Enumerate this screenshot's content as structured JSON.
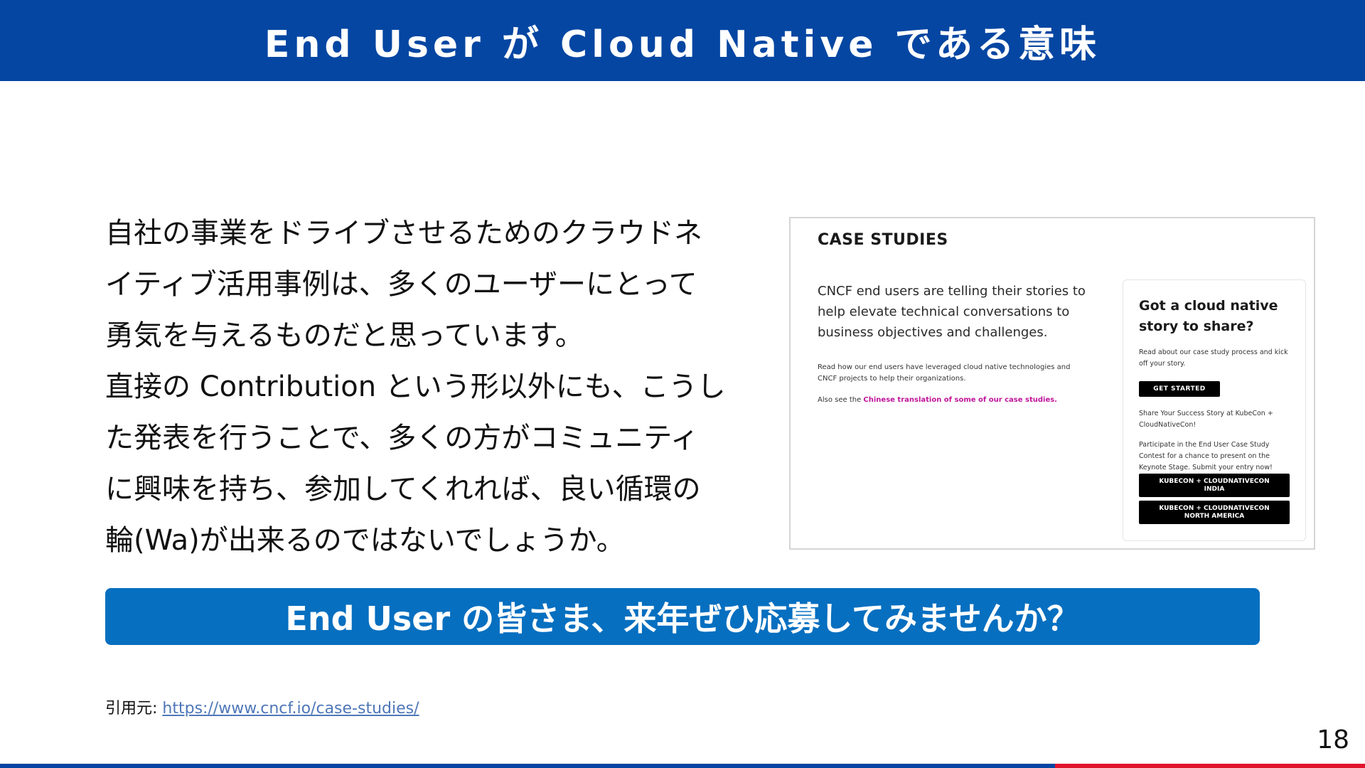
{
  "slide": {
    "title": "End User が Cloud Native である意味",
    "page_number": "18"
  },
  "body": {
    "lines": [
      "自社の事業をドライブさせるためのクラウドネ",
      "イティブ活用事例は、多くのユーザーにとって",
      "勇気を与えるものだと思っています。",
      "直接の Contribution という形以外にも、こうし",
      "た発表を行うことで、多くの方がコミュニティ",
      "に興味を持ち、参加してくれれば、良い循環の",
      "輪(Wa)が出来るのではないでしょうか。"
    ]
  },
  "screenshot": {
    "heading": "CASE STUDIES",
    "intro": "CNCF end users are telling their stories to help elevate technical conversations to business objectives and challenges.",
    "small_text": "Read how our end users have leveraged cloud native technologies and CNCF projects to help their organizations.",
    "also_prefix": "Also see the ",
    "also_link": "Chinese translation of some of our case studies.",
    "card": {
      "title": "Got a cloud native story to share?",
      "description": "Read about our case study process and kick off your story.",
      "get_started_label": "GET STARTED",
      "share_text": "Share Your Success Story at KubeCon + CloudNativeCon!",
      "participate_text": "Participate in the End User Case Study Contest for a chance to present on the Keynote Stage. Submit your entry now!",
      "india_button_label": "KUBECON + CLOUDNATIVECON INDIA",
      "na_button_label": "KUBECON + CLOUDNATIVECON NORTH AMERICA"
    }
  },
  "cta": {
    "text": "End User の皆さま、来年ぜひ応募してみませんか？"
  },
  "citation": {
    "label": "引用元: ",
    "url": "https://www.cncf.io/case-studies/"
  },
  "colors": {
    "title_bar": "#0446a2",
    "cta_bar": "#066fc0",
    "bottom_accent_red": "#e0142d",
    "link_magenta": "#c0149a",
    "citation_link": "#4e77b8"
  }
}
